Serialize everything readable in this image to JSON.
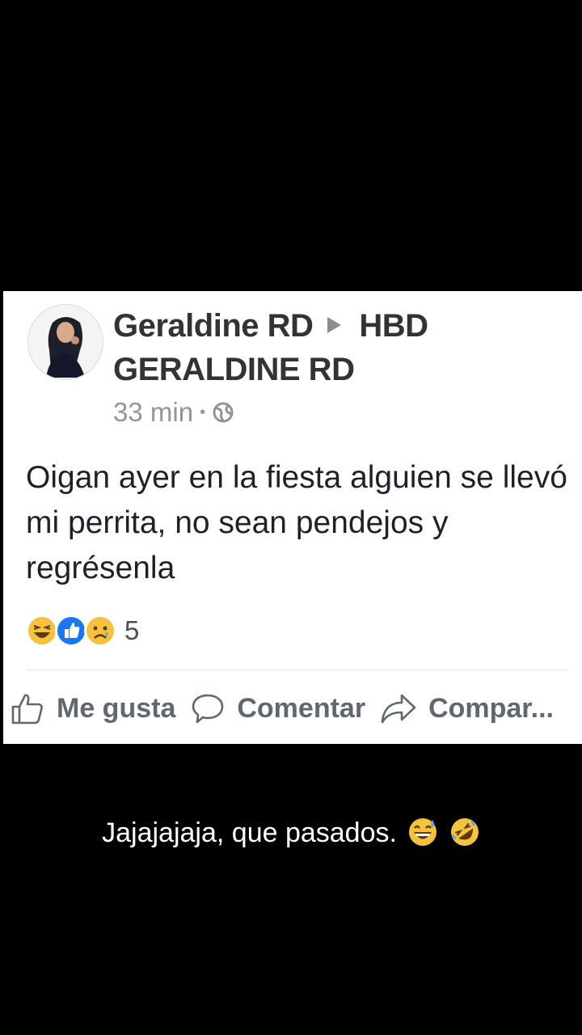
{
  "post": {
    "author": "Geraldine RD",
    "target": "HBD GERALDINE RD",
    "time": "33 min",
    "separator": "•",
    "privacy_icon": "globe-icon",
    "text": "Oigan ayer en la fiesta alguien se llevó mi perrita, no sean pendejos y regrésenla",
    "reactions": [
      "haha-emoji",
      "like-icon",
      "sad-emoji"
    ],
    "reaction_count": "5"
  },
  "actions": {
    "like_label": "Me gusta",
    "comment_label": "Comentar",
    "share_label": "Compar..."
  },
  "caption": {
    "text": "Jajajajaja, que pasados.",
    "emojis": [
      "grinning-sweat-emoji",
      "rolling-laughing-emoji"
    ]
  },
  "colors": {
    "background": "#000000",
    "card": "#ffffff",
    "like_blue": "#1877f2",
    "emoji_yellow": "#f7c23b"
  }
}
